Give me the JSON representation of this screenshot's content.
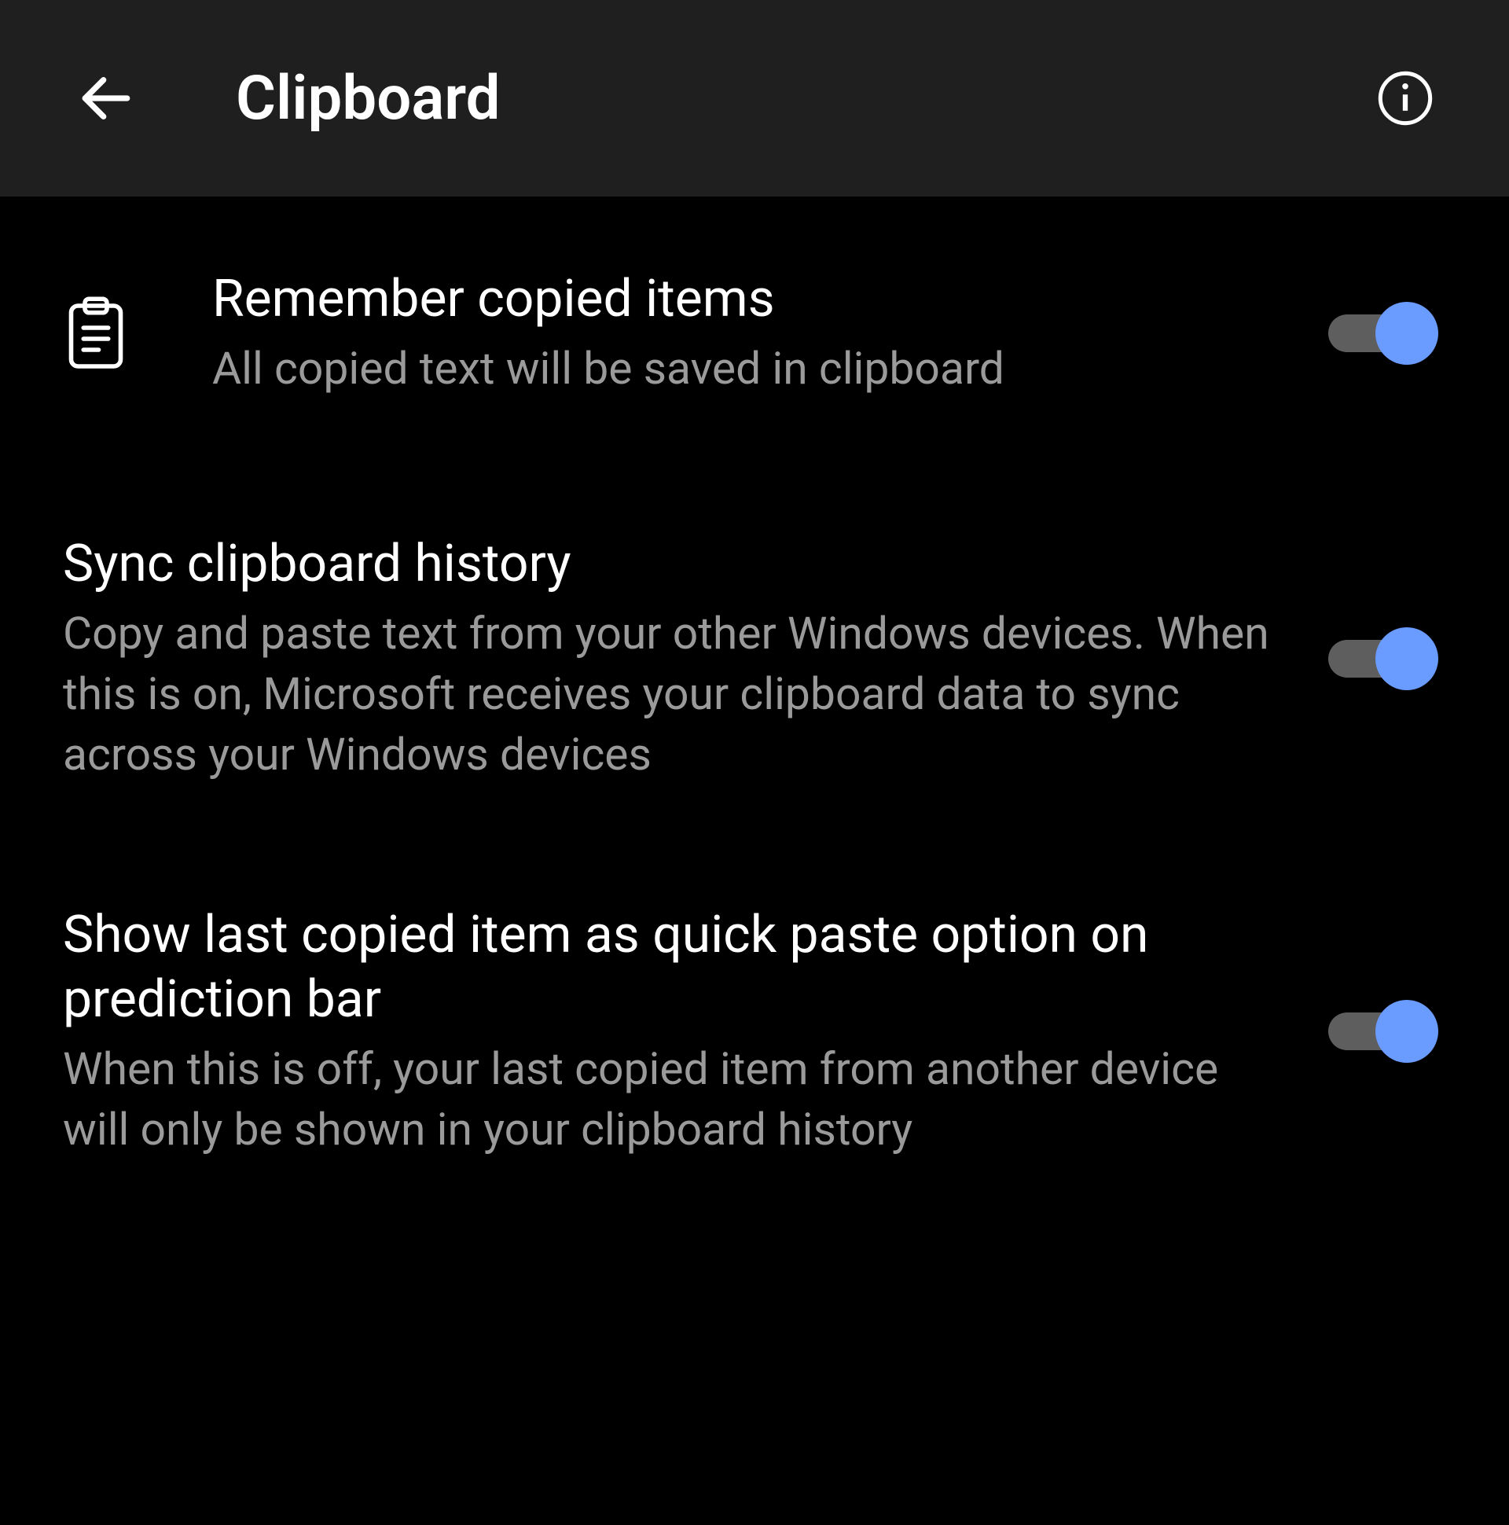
{
  "header": {
    "title": "Clipboard"
  },
  "settings": [
    {
      "title": "Remember copied items",
      "desc": "All copied text will be saved in clipboard",
      "toggled": true
    },
    {
      "title": "Sync clipboard history",
      "desc": "Copy and paste text from your other Windows devices. When this is on, Microsoft receives your clipboard data to sync across your Windows devices",
      "toggled": true
    },
    {
      "title": "Show last copied item as quick paste option on prediction bar",
      "desc": "When this is off, your last copied item from another device will only be shown in your clipboard history",
      "toggled": true
    }
  ]
}
